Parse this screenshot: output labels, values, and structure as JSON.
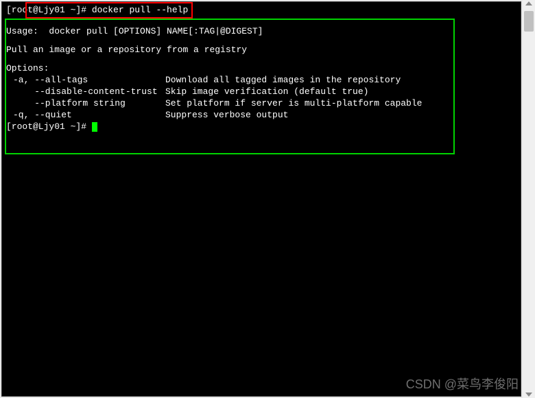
{
  "prompt1": {
    "user_host": "[root@Ljy01 ~]#",
    "command": "docker pull --help"
  },
  "usage": "Usage:  docker pull [OPTIONS] NAME[:TAG|@DIGEST]",
  "description": "Pull an image or a repository from a registry",
  "options_header": "Options:",
  "options": [
    {
      "flag": "-a, --all-tags",
      "desc": "Download all tagged images in the repository"
    },
    {
      "flag": "    --disable-content-trust",
      "desc": "Skip image verification (default true)"
    },
    {
      "flag": "    --platform string",
      "desc": "Set platform if server is multi-platform capable"
    },
    {
      "flag": "-q, --quiet",
      "desc": "Suppress verbose output"
    }
  ],
  "prompt2": {
    "user_host": "[root@Ljy01 ~]#"
  },
  "watermark": "CSDN @菜鸟李俊阳"
}
